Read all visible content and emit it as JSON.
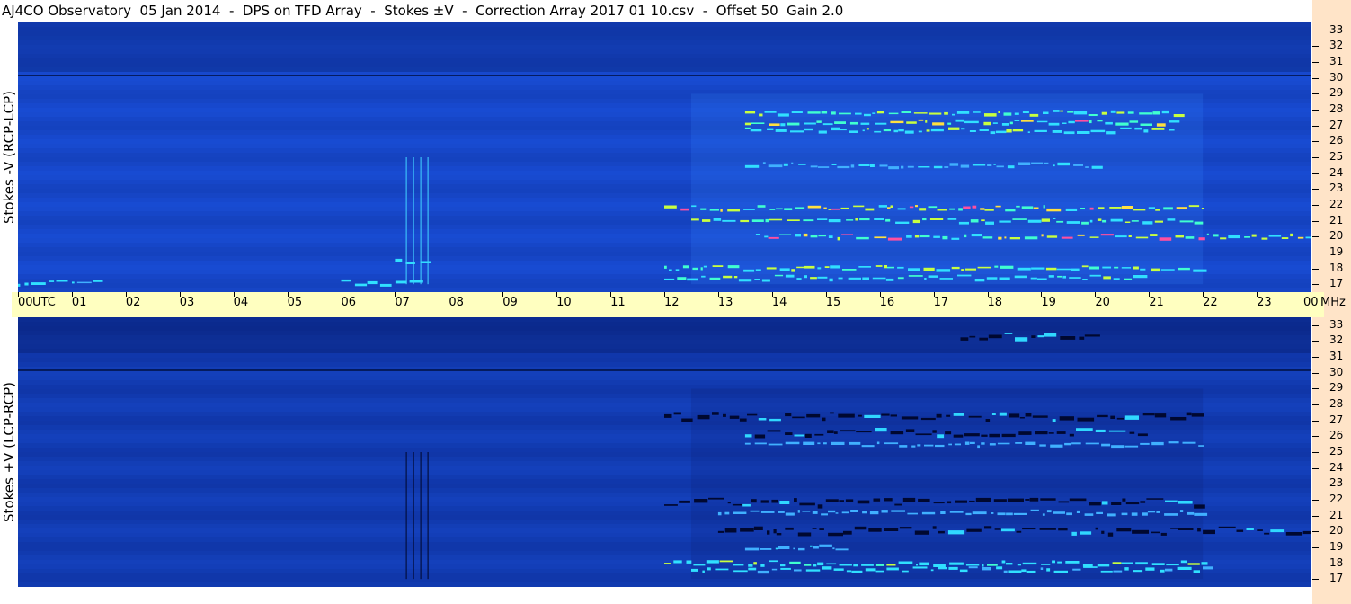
{
  "title": "AJ4CO Observatory  05 Jan 2014  -  DPS on TFD Array  -  Stokes ±V  -  Correction Array 2017 01 10.csv  -  Offset 50  Gain 2.0",
  "panels": {
    "top": {
      "label": "Stokes -V (RCP-LCP)"
    },
    "bottom": {
      "label": "Stokes +V (LCP-RCP)"
    }
  },
  "time_axis": {
    "ticks": [
      "00",
      "01",
      "02",
      "03",
      "04",
      "05",
      "06",
      "07",
      "08",
      "09",
      "10",
      "11",
      "12",
      "13",
      "14",
      "15",
      "16",
      "17",
      "18",
      "19",
      "20",
      "21",
      "22",
      "23",
      "00"
    ],
    "unit_label": "UTC",
    "freq_unit_label": "MHz"
  },
  "freq_axis": {
    "ticks": [
      "33",
      "32",
      "31",
      "30",
      "29",
      "28",
      "27",
      "26",
      "25",
      "24",
      "23",
      "22",
      "21",
      "20",
      "19",
      "18",
      "17"
    ]
  },
  "colors": {
    "background_blue": "#1a4fd8",
    "dark_blue": "#0a2f9a",
    "time_axis_bg": "#ffffc0",
    "right_strip_bg": "#ffe4c8"
  },
  "chart_data": {
    "type": "heatmap",
    "title": "AJ4CO Observatory  05 Jan 2014  -  DPS on TFD Array  -  Stokes ±V  -  Correction Array 2017 01 10.csv  -  Offset 50  Gain 2.0",
    "x_unit": "UTC",
    "x_range": [
      0,
      24
    ],
    "y_unit": "MHz",
    "y_range": [
      16.5,
      33.5
    ],
    "panels": [
      {
        "name": "Stokes -V (RCP-LCP)",
        "bright_bands": [
          {
            "t0": 13.5,
            "t1": 21.5,
            "f": 27.8,
            "level": 0.9
          },
          {
            "t0": 13.5,
            "t1": 21.5,
            "f": 27.2,
            "level": 0.95
          },
          {
            "t0": 13.5,
            "t1": 21.5,
            "f": 26.7,
            "level": 0.8
          },
          {
            "t0": 12.0,
            "t1": 22.0,
            "f": 21.8,
            "level": 1.0
          },
          {
            "t0": 12.5,
            "t1": 22.0,
            "f": 21.0,
            "level": 0.9
          },
          {
            "t0": 13.7,
            "t1": 24.0,
            "f": 20.0,
            "level": 1.0
          },
          {
            "t0": 12.0,
            "t1": 22.0,
            "f": 18.0,
            "level": 0.9
          },
          {
            "t0": 12.0,
            "t1": 21.0,
            "f": 17.4,
            "level": 0.8
          },
          {
            "t0": 0.0,
            "t1": 1.5,
            "f": 17.1,
            "level": 0.7
          },
          {
            "t0": 6.0,
            "t1": 7.5,
            "f": 17.1,
            "level": 0.8
          },
          {
            "t0": 13.5,
            "t1": 20.0,
            "f": 24.5,
            "level": 0.6
          },
          {
            "t0": 7.0,
            "t1": 7.6,
            "f": 18.5,
            "level": 0.7
          }
        ]
      },
      {
        "name": "Stokes +V (LCP-RCP)",
        "bright_bands": [
          {
            "t0": 12.0,
            "t1": 22.0,
            "f": 18.0,
            "level": 0.8
          },
          {
            "t0": 12.5,
            "t1": 22.0,
            "f": 17.6,
            "level": 0.7
          },
          {
            "t0": 13.0,
            "t1": 22.0,
            "f": 21.2,
            "level": 0.5
          },
          {
            "t0": 13.5,
            "t1": 15.2,
            "f": 19.0,
            "level": 0.6
          },
          {
            "t0": 13.5,
            "t1": 22.0,
            "f": 25.5,
            "level": 0.45
          }
        ],
        "dark_bands": [
          {
            "t0": 12.0,
            "t1": 22.0,
            "f": 27.2
          },
          {
            "t0": 13.5,
            "t1": 21.0,
            "f": 26.2
          },
          {
            "t0": 12.0,
            "t1": 22.0,
            "f": 21.8
          },
          {
            "t0": 13.0,
            "t1": 24.0,
            "f": 20.0
          },
          {
            "t0": 17.5,
            "t1": 20.0,
            "f": 32.3
          }
        ]
      }
    ]
  }
}
